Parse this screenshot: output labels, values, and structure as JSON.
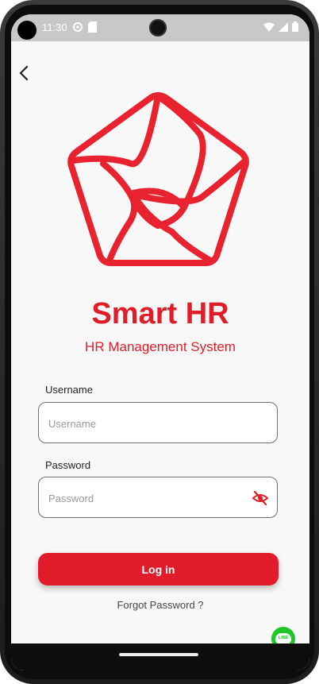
{
  "status_bar": {
    "time": "11:30"
  },
  "nav": {
    "back_icon": "chevron-left-icon"
  },
  "brand": {
    "logo_icon": "pentagon-shutter-logo",
    "title": "Smart HR",
    "subtitle": "HR Management System",
    "accent_color": "#e11d2a"
  },
  "form": {
    "username_label": "Username",
    "username_placeholder": "Username",
    "username_value": "",
    "password_label": "Password",
    "password_placeholder": "Password",
    "password_value": "",
    "password_toggle_icon": "eye-off-icon"
  },
  "actions": {
    "login_label": "Log in",
    "forgot_label": "Forgot Password ?"
  },
  "floating": {
    "line_icon": "line-chat-icon",
    "line_text": "LINE"
  }
}
